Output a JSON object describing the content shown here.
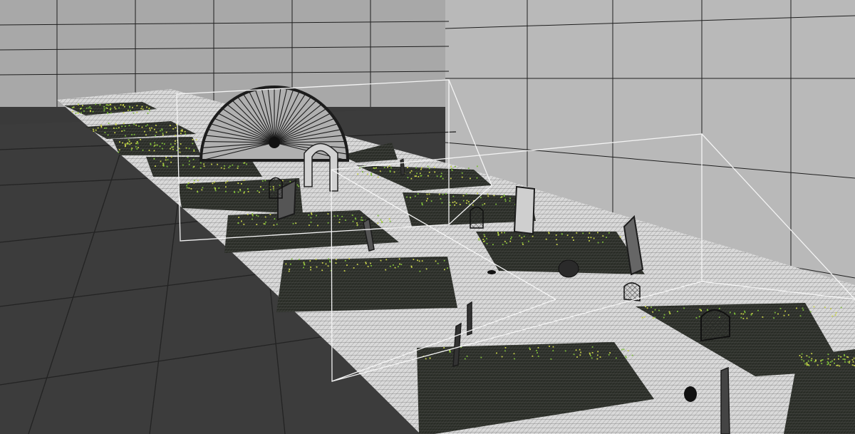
{
  "viewport": {
    "view": "3d-perspective",
    "display_mode": "wireframe-on-shaded",
    "colors": {
      "background_wall": "#a8a8a8",
      "floor_dark": "#3c3c3c",
      "side_wall": "#b9b9b9",
      "grid_line": "#1e1e1e",
      "ground_plane": "#d9d9d9",
      "terrain_patch": "#2a2d27",
      "foliage_point_green": "#7dbb3a",
      "foliage_point_yellow": "#c8d24a",
      "camera_frustum": "#f4f4f4",
      "object_dark": "#2b2b2b",
      "object_light": "#cfcfcf"
    }
  },
  "scene_objects": [
    {
      "name": "ground-plane-mesh",
      "kind": "mesh"
    },
    {
      "name": "terrain-patch",
      "kind": "mesh",
      "count": 12
    },
    {
      "name": "fan-wheel-model",
      "kind": "mesh"
    },
    {
      "name": "stone-arch-model",
      "kind": "mesh"
    },
    {
      "name": "standing-panel",
      "kind": "mesh",
      "count": 8
    },
    {
      "name": "lattice-tombstone",
      "kind": "mesh",
      "count": 4
    },
    {
      "name": "camera-frustum",
      "kind": "camera",
      "count": 2
    }
  ]
}
